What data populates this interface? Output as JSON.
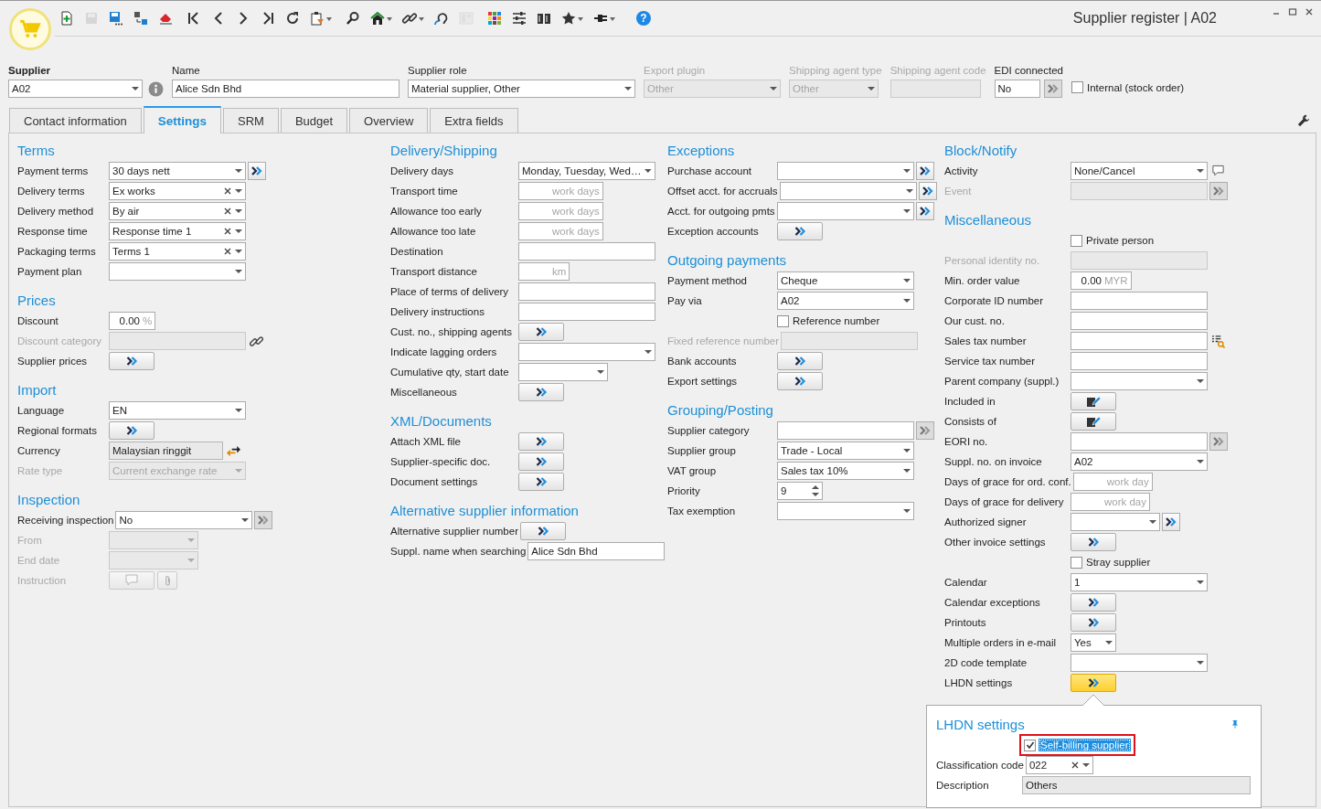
{
  "window": {
    "title": "Supplier register | A02"
  },
  "toolbar": [
    {
      "disabled": false
    },
    {
      "disabled": true
    },
    {
      "disabled": false
    },
    {
      "disabled": false
    },
    {
      "disabled": false
    },
    {
      "disabled": false
    },
    {
      "disabled": false
    },
    {
      "disabled": false
    },
    {
      "disabled": false
    },
    {
      "disabled": false
    },
    {
      "disabled": false,
      "menu": true
    },
    {
      "disabled": false
    },
    {
      "disabled": false,
      "menu": true
    },
    {
      "disabled": false,
      "menu": true
    },
    {
      "disabled": false
    },
    {
      "disabled": true
    },
    {
      "disabled": false
    },
    {
      "disabled": false
    },
    {
      "disabled": false
    },
    {
      "disabled": false,
      "menu": true
    },
    {
      "disabled": false,
      "menu": true
    },
    {
      "disabled": false,
      "glyph": "?"
    }
  ],
  "header": [
    {
      "label": "Supplier",
      "kind": "combo",
      "value": "A02",
      "disabled": false,
      "addon": {
        "kind": "info"
      }
    },
    {
      "label": "Name",
      "kind": "field",
      "value": "Alice Sdn Bhd",
      "disabled": false
    },
    {
      "label": "Supplier role",
      "kind": "combo",
      "value": "Material supplier, Other",
      "disabled": false
    },
    {
      "label": "Export plugin",
      "kind": "combo",
      "value": "Other",
      "disabled": true
    },
    {
      "label": "Shipping agent type",
      "kind": "combo",
      "value": "Other",
      "disabled": true
    },
    {
      "label": "Shipping agent code",
      "kind": "field",
      "disabled": true
    },
    {
      "label": "EDI connected",
      "kind": "field",
      "value": "No",
      "disabled": false,
      "link": {
        "disabled": true
      }
    },
    {
      "label": "Internal (stock order)",
      "kind": "check",
      "checked": false,
      "disabled": false
    }
  ],
  "tabs": [
    {
      "label": "Contact information",
      "selected": false
    },
    {
      "label": "Settings",
      "selected": true
    },
    {
      "label": "SRM",
      "selected": false
    },
    {
      "label": "Budget",
      "selected": false
    },
    {
      "label": "Overview",
      "selected": false
    },
    {
      "label": "Extra fields",
      "selected": false
    }
  ],
  "columns": [
    {
      "sections": [
        {
          "title": "Terms",
          "rows": [
            {
              "label": "Payment terms",
              "kind": "combo",
              "value": "30 days nett",
              "clear": false,
              "disabled": false,
              "link": {
                "disabled": false
              }
            },
            {
              "label": "Delivery terms",
              "kind": "combo",
              "value": "Ex works",
              "clear": true,
              "disabled": false
            },
            {
              "label": "Delivery method",
              "kind": "combo",
              "value": "By air",
              "clear": true,
              "disabled": false
            },
            {
              "label": "Response time",
              "kind": "combo",
              "value": "Response time 1",
              "clear": true,
              "disabled": false
            },
            {
              "label": "Packaging terms",
              "kind": "combo",
              "value": "Terms 1",
              "clear": true,
              "disabled": false
            },
            {
              "label": "Payment plan",
              "kind": "combo",
              "clear": false,
              "disabled": false
            }
          ]
        },
        {
          "title": "Prices",
          "rows": [
            {
              "label": "Discount",
              "kind": "unit",
              "value": "0.00",
              "unit": "%",
              "disabled": false
            },
            {
              "label": "Discount category",
              "kind": "field",
              "disabled": true,
              "addon": {
                "kind": "link"
              }
            },
            {
              "label": "Supplier prices",
              "kind": "button",
              "highlight": false,
              "disabled": false
            }
          ]
        },
        {
          "title": "Import",
          "rows": [
            {
              "label": "Language",
              "kind": "combo",
              "value": "EN",
              "clear": false,
              "disabled": false
            },
            {
              "label": "Regional formats",
              "kind": "button",
              "highlight": false,
              "disabled": false
            },
            {
              "label": "Currency",
              "kind": "readonly",
              "value": "Malaysian ringgit",
              "disabled": false,
              "addon": {
                "kind": "swap"
              }
            },
            {
              "label": "Rate type",
              "kind": "combo",
              "value": "Current exchange rate",
              "clear": false,
              "disabled": true
            }
          ]
        },
        {
          "title": "Inspection",
          "rows": [
            {
              "label": "Receiving inspection",
              "kind": "combo",
              "value": "No",
              "clear": false,
              "disabled": false,
              "link": {
                "disabled": true
              }
            },
            {
              "label": "From",
              "kind": "select",
              "disabled": true
            },
            {
              "label": "End date",
              "kind": "select",
              "disabled": true
            },
            {
              "label": "Instruction",
              "kind": "instruction",
              "disabled": true
            }
          ]
        }
      ]
    },
    {
      "sections": [
        {
          "title": "Delivery/Shipping",
          "rows": [
            {
              "label": "Delivery days",
              "kind": "combo",
              "value": "Monday, Tuesday, Wed…",
              "clear": false,
              "disabled": false
            },
            {
              "label": "Transport time",
              "kind": "unit",
              "unit": "work days",
              "disabled": false
            },
            {
              "label": "Allowance too early",
              "kind": "unit",
              "unit": "work days",
              "disabled": false
            },
            {
              "label": "Allowance too late",
              "kind": "unit",
              "unit": "work days",
              "disabled": false
            },
            {
              "label": "Destination",
              "kind": "field",
              "disabled": false
            },
            {
              "label": "Transport distance",
              "kind": "unit",
              "unit": "km",
              "disabled": false
            },
            {
              "label": "Place of terms of delivery",
              "kind": "field",
              "disabled": false
            },
            {
              "label": "Delivery instructions",
              "kind": "field",
              "disabled": false
            },
            {
              "label": "Cust. no., shipping agents",
              "kind": "button",
              "highlight": false,
              "disabled": false
            },
            {
              "label": "Indicate lagging orders",
              "kind": "combo",
              "clear": false,
              "disabled": false
            },
            {
              "label": "Cumulative qty, start date",
              "kind": "select",
              "disabled": false
            },
            {
              "label": "Miscellaneous",
              "kind": "button",
              "highlight": false,
              "disabled": false
            }
          ]
        },
        {
          "title": "XML/Documents",
          "rows": [
            {
              "label": "Attach XML file",
              "kind": "button",
              "highlight": false,
              "disabled": false
            },
            {
              "label": "Supplier-specific doc.",
              "kind": "button",
              "highlight": false,
              "disabled": false
            },
            {
              "label": "Document settings",
              "kind": "button",
              "highlight": false,
              "disabled": false
            }
          ]
        },
        {
          "title": "Alternative supplier information",
          "rows": [
            {
              "label": "Alternative supplier number",
              "kind": "button",
              "highlight": false,
              "disabled": false
            },
            {
              "label": "Suppl. name when searching",
              "kind": "field",
              "value": "Alice Sdn Bhd",
              "disabled": false
            }
          ]
        }
      ]
    },
    {
      "sections": [
        {
          "title": "Exceptions",
          "rows": [
            {
              "label": "Purchase account",
              "kind": "combo",
              "clear": false,
              "disabled": false,
              "link": {
                "disabled": false
              }
            },
            {
              "label": "Offset acct. for accruals",
              "kind": "combo",
              "clear": false,
              "disabled": false,
              "link": {
                "disabled": false
              }
            },
            {
              "label": "Acct. for outgoing pmts",
              "kind": "combo",
              "clear": false,
              "disabled": false,
              "link": {
                "disabled": false
              }
            },
            {
              "label": "Exception accounts",
              "kind": "button",
              "highlight": false,
              "disabled": false
            }
          ]
        },
        {
          "title": "Outgoing payments",
          "rows": [
            {
              "label": "Payment method",
              "kind": "combo",
              "value": "Cheque",
              "clear": false,
              "disabled": false
            },
            {
              "label": "Pay via",
              "kind": "combo",
              "value": "A02",
              "clear": false,
              "disabled": false
            },
            {
              "label": "Reference number",
              "kind": "check",
              "checked": false,
              "disabled": false
            },
            {
              "label": "Fixed reference number",
              "kind": "field",
              "disabled": true
            },
            {
              "label": "Bank accounts",
              "kind": "button",
              "highlight": false,
              "disabled": false
            },
            {
              "label": "Export settings",
              "kind": "button",
              "highlight": false,
              "disabled": false
            }
          ]
        },
        {
          "title": "Grouping/Posting",
          "rows": [
            {
              "label": "Supplier category",
              "kind": "field",
              "disabled": false,
              "link": {
                "disabled": true
              }
            },
            {
              "label": "Supplier group",
              "kind": "combo",
              "value": "Trade - Local",
              "clear": false,
              "disabled": false
            },
            {
              "label": "VAT group",
              "kind": "combo",
              "value": "Sales tax 10%",
              "clear": false,
              "disabled": false
            },
            {
              "label": "Priority",
              "kind": "spin",
              "value": "9",
              "disabled": false
            },
            {
              "label": "Tax exemption",
              "kind": "combo",
              "clear": false,
              "disabled": false
            }
          ]
        }
      ]
    },
    {
      "sections": [
        {
          "title": "Block/Notify",
          "rows": [
            {
              "label": "Activity",
              "kind": "combo",
              "value": "None/Cancel",
              "clear": false,
              "disabled": false,
              "addon": {
                "kind": "note"
              }
            },
            {
              "label": "Event",
              "kind": "field",
              "disabled": true,
              "link": {
                "disabled": true
              }
            }
          ]
        },
        {
          "title": "Miscellaneous",
          "rows": [
            {
              "label": "Private person",
              "kind": "check",
              "checked": false,
              "disabled": false
            },
            {
              "label": "Personal identity no.",
              "kind": "field",
              "disabled": true
            },
            {
              "label": "Min. order value",
              "kind": "unit",
              "value": "0.00",
              "unit": "MYR",
              "disabled": false
            },
            {
              "label": "Corporate ID number",
              "kind": "field",
              "disabled": false
            },
            {
              "label": "Our cust. no.",
              "kind": "field",
              "disabled": false
            },
            {
              "label": "Sales tax number",
              "kind": "field",
              "disabled": false,
              "addon": {
                "kind": "lookup"
              }
            },
            {
              "label": "Service tax number",
              "kind": "field",
              "disabled": false
            },
            {
              "label": "Parent company (suppl.)",
              "kind": "combo",
              "clear": false,
              "disabled": false
            },
            {
              "label": "Included in",
              "kind": "edit",
              "disabled": false
            },
            {
              "label": "Consists of",
              "kind": "edit",
              "disabled": false
            },
            {
              "label": "EORI no.",
              "kind": "field",
              "disabled": false,
              "link": {
                "disabled": true
              }
            },
            {
              "label": "Suppl. no. on invoice",
              "kind": "combo",
              "value": "A02",
              "clear": false,
              "disabled": false
            },
            {
              "label": "Days of grace for ord. conf.",
              "kind": "unit",
              "unit": "work day",
              "disabled": false
            },
            {
              "label": "Days of grace for delivery",
              "kind": "unit",
              "unit": "work day",
              "disabled": false
            },
            {
              "label": "Authorized signer",
              "kind": "select",
              "disabled": false,
              "link": {
                "disabled": false
              }
            },
            {
              "label": "Other invoice settings",
              "kind": "button",
              "highlight": false,
              "disabled": false
            },
            {
              "label": "Stray supplier",
              "kind": "check",
              "checked": false,
              "disabled": false
            },
            {
              "label": "Calendar",
              "kind": "combo",
              "value": "1",
              "clear": false,
              "disabled": false
            },
            {
              "label": "Calendar exceptions",
              "kind": "button",
              "highlight": false,
              "disabled": false
            },
            {
              "label": "Printouts",
              "kind": "button",
              "highlight": false,
              "disabled": false
            },
            {
              "label": "Multiple orders in e-mail",
              "kind": "mini",
              "value": "Yes",
              "disabled": false
            },
            {
              "label": "2D code template",
              "kind": "combo",
              "clear": false,
              "disabled": false
            },
            {
              "label": "LHDN settings",
              "kind": "button",
              "highlight": true,
              "disabled": false
            }
          ]
        }
      ]
    }
  ],
  "lhdn_popup": {
    "title": "LHDN settings",
    "check": {
      "label": "Self-billing supplier",
      "checked": true,
      "focused": true,
      "annotated": true
    },
    "rows": [
      {
        "label": "Classification code",
        "kind": "code",
        "value": "022",
        "clear": true
      },
      {
        "label": "Description",
        "kind": "wide",
        "value": "Others"
      }
    ]
  }
}
